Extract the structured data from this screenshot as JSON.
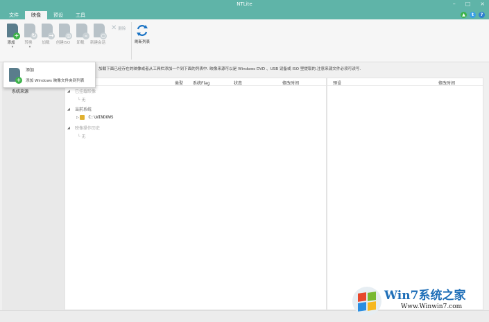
{
  "window": {
    "title": "NTLite",
    "controls": [
      "–",
      "□",
      "×"
    ]
  },
  "menu": {
    "tabs": [
      "文件",
      "映像",
      "预设",
      "工具"
    ]
  },
  "colors": {
    "titlebar": "#5fb4a8",
    "accent_green": "#3db34a",
    "refresh_blue": "#1a73c4"
  },
  "ribbon": {
    "add_label": "添加",
    "convert_label": "转换",
    "load_label": "加载",
    "iso_label": "创建ISO",
    "unload_label": "卸载",
    "new_vhd_label": "新建会话",
    "delete_label": "删除",
    "refresh_label": "刷新列表"
  },
  "hint": "加载下面已经存在的映像或者从工具栏添加一个到下面的列表中. 映像来源可以是 Windows DVD 、USB 设备或 ISO 里提取的.注意来源文件必须可读写.",
  "sidebar": {
    "item": "系统来源"
  },
  "table": {
    "headers": {
      "type": "类型",
      "arch": "系统Flag",
      "status": "状态",
      "modified": "修改时间"
    },
    "groups": [
      {
        "label": "已挂载映像",
        "child": "无"
      },
      {
        "label": "当前系统",
        "child": "C:\\WINDOWS"
      },
      {
        "label": "映像操作历史",
        "child": "无"
      }
    ]
  },
  "right_panel": {
    "headers": {
      "preset": "预设",
      "modified": "修改时间"
    }
  },
  "popup": {
    "title": "添加",
    "desc": "添加 Windows 映像文件夹到列表"
  },
  "watermark": {
    "brand": "Win7系统之家",
    "url": "Www.Winwin7.com"
  }
}
